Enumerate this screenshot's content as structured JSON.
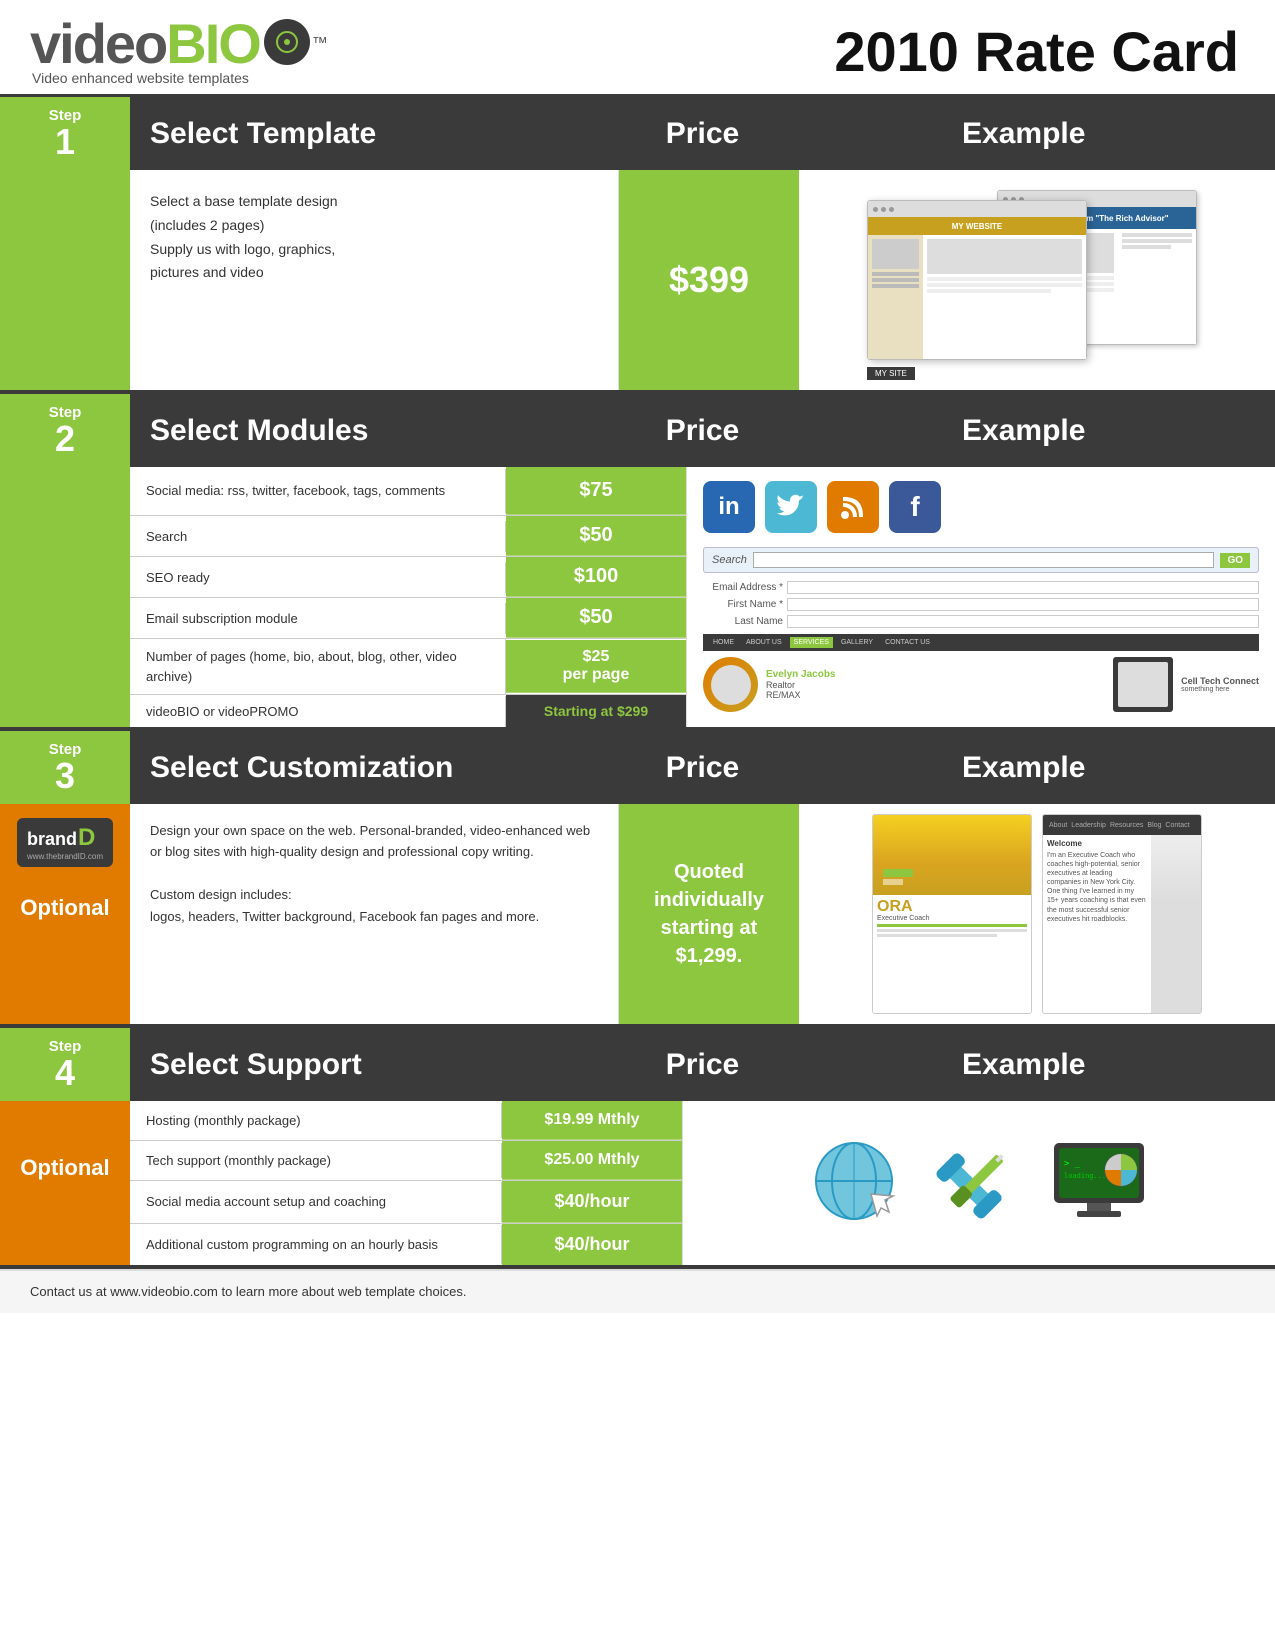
{
  "header": {
    "logo_video": "video",
    "logo_bio": "BIO",
    "logo_tm": "™",
    "logo_subtitle": "Video enhanced website templates",
    "rate_card_title": "2010 Rate Card"
  },
  "step1": {
    "step_num": "Step",
    "step_word": "1",
    "header_title": "Select Template",
    "header_price": "Price",
    "header_example": "Example",
    "price": "$399",
    "description_line1": "Select a base template design",
    "description_line2": "(includes 2 pages)",
    "description_line3": "Supply us with logo, graphics,",
    "description_line4": "pictures and video"
  },
  "step2": {
    "step_num": "Step",
    "step_word": "2",
    "header_title": "Select Modules",
    "header_price": "Price",
    "header_example": "Example",
    "modules": [
      {
        "desc": "Social media: rss, twitter, facebook, tags, comments",
        "price": "$75"
      },
      {
        "desc": "Search",
        "price": "$50"
      },
      {
        "desc": "SEO ready",
        "price": "$100"
      },
      {
        "desc": "Email subscription module",
        "price": "$50"
      },
      {
        "desc": "Number of pages (home, bio, about, blog, other, video archive)",
        "price": "$25\nper page"
      },
      {
        "desc": "videoBIO or videoPROMO",
        "price": "Starting at $299",
        "dark": true
      }
    ]
  },
  "step3": {
    "step_num": "Step",
    "step_word": "3",
    "optional": "Optional",
    "header_title": "Select Customization",
    "header_price": "Price",
    "header_example": "Example",
    "price": "Quoted individually starting at $1,299.",
    "description": "Design your own space on the web. Personal-branded, video-enhanced web or blog sites with high-quality design and professional copy writing.\n\nCustom design includes:\nlogos, headers, Twitter background, Facebook fan pages and more.",
    "brand_logo_text": "brand",
    "brand_logo_d": "D",
    "brand_url": "www.thebrandID.com"
  },
  "step4": {
    "step_num": "Step",
    "step_word": "4",
    "optional": "Optional",
    "header_title": "Select Support",
    "header_price": "Price",
    "header_example": "Example",
    "items": [
      {
        "desc": "Hosting (monthly package)",
        "price": "$19.99 Mthly"
      },
      {
        "desc": "Tech support (monthly package)",
        "price": "$25.00 Mthly"
      },
      {
        "desc": "Social media account setup and coaching",
        "price": "$40/hour"
      },
      {
        "desc": "Additional custom programming on an hourly basis",
        "price": "$40/hour"
      }
    ]
  },
  "footer": {
    "text": "Contact us at www.videobio.com to learn more about web template choices."
  },
  "nav_items": [
    "HOME",
    "ABOUT US",
    "SERVICES",
    "GALLERY",
    "CONTACT US"
  ],
  "colors": {
    "green": "#8dc63f",
    "dark": "#3a3a3a",
    "orange": "#e07b00"
  }
}
